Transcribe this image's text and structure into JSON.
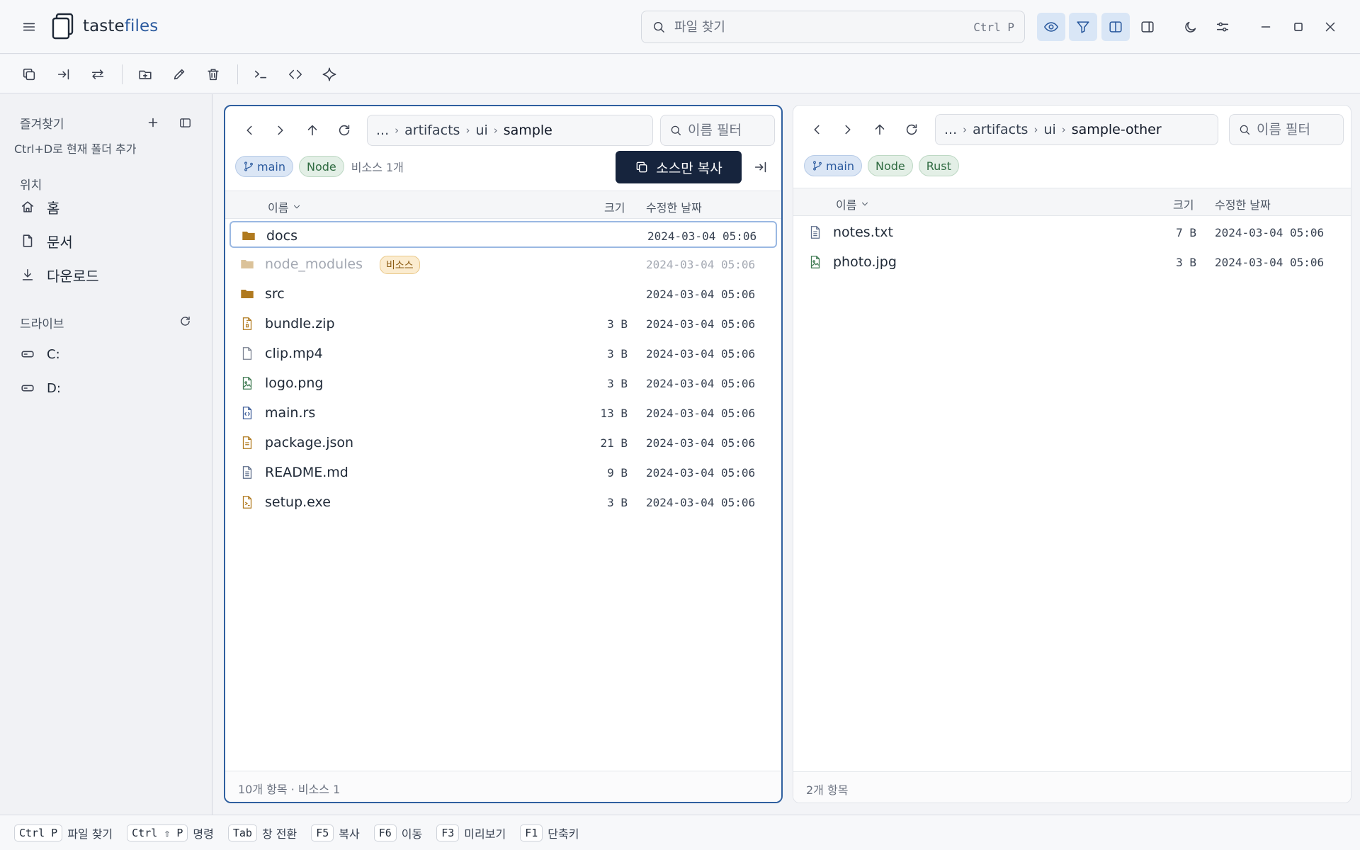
{
  "app": {
    "title_a": "taste",
    "title_b": "files"
  },
  "search": {
    "placeholder": "파일 찾기",
    "shortcut": "Ctrl P"
  },
  "sidebar": {
    "favorites_title": "즐겨찾기",
    "favorites_hint": "Ctrl+D로 현재 폴더 추가",
    "locations_title": "위치",
    "locations": [
      {
        "label": "홈",
        "icon": "home-icon"
      },
      {
        "label": "문서",
        "icon": "document-icon"
      },
      {
        "label": "다운로드",
        "icon": "download-icon"
      }
    ],
    "drives_title": "드라이브",
    "drives": [
      {
        "label": "C:"
      },
      {
        "label": "D:"
      }
    ]
  },
  "left": {
    "breadcrumb": [
      "...",
      "artifacts",
      "ui",
      "sample"
    ],
    "filter_placeholder": "이름 필터",
    "chips": [
      "main",
      "Node"
    ],
    "note": "비소스 1개",
    "copy_label": "소스만 복사",
    "headers": {
      "name": "이름",
      "size": "크기",
      "date": "수정한 날짜"
    },
    "rows": [
      {
        "name": "docs",
        "size": "",
        "date": "2024-03-04 05:06",
        "type": "folder",
        "selected": true
      },
      {
        "name": "node_modules",
        "size": "",
        "date": "2024-03-04 05:06",
        "type": "folder",
        "dim": true,
        "badge": "비소스"
      },
      {
        "name": "src",
        "size": "",
        "date": "2024-03-04 05:06",
        "type": "folder"
      },
      {
        "name": "bundle.zip",
        "size": "3 B",
        "date": "2024-03-04 05:06",
        "type": "zip"
      },
      {
        "name": "clip.mp4",
        "size": "3 B",
        "date": "2024-03-04 05:06",
        "type": "file"
      },
      {
        "name": "logo.png",
        "size": "3 B",
        "date": "2024-03-04 05:06",
        "type": "image"
      },
      {
        "name": "main.rs",
        "size": "13 B",
        "date": "2024-03-04 05:06",
        "type": "code"
      },
      {
        "name": "package.json",
        "size": "21 B",
        "date": "2024-03-04 05:06",
        "type": "json"
      },
      {
        "name": "README.md",
        "size": "9 B",
        "date": "2024-03-04 05:06",
        "type": "text"
      },
      {
        "name": "setup.exe",
        "size": "3 B",
        "date": "2024-03-04 05:06",
        "type": "exe"
      }
    ],
    "status": "10개 항목 · 비소스 1"
  },
  "right": {
    "breadcrumb": [
      "...",
      "artifacts",
      "ui",
      "sample-other"
    ],
    "filter_placeholder": "이름 필터",
    "chips": [
      "main",
      "Node",
      "Rust"
    ],
    "headers": {
      "name": "이름",
      "size": "크기",
      "date": "수정한 날짜"
    },
    "rows": [
      {
        "name": "notes.txt",
        "size": "7 B",
        "date": "2024-03-04 05:06",
        "type": "text"
      },
      {
        "name": "photo.jpg",
        "size": "3 B",
        "date": "2024-03-04 05:06",
        "type": "image"
      }
    ],
    "status": "2개 항목"
  },
  "shortcuts": [
    {
      "key": "Ctrl P",
      "label": "파일 찾기"
    },
    {
      "key": "Ctrl ⇧ P",
      "label": "명령"
    },
    {
      "key": "Tab",
      "label": "창 전환"
    },
    {
      "key": "F5",
      "label": "복사"
    },
    {
      "key": "F6",
      "label": "이동"
    },
    {
      "key": "F3",
      "label": "미리보기"
    },
    {
      "key": "F1",
      "label": "단축키"
    }
  ],
  "colors": {
    "accent": "#2f5f9f",
    "primary_button": "#16243d",
    "folder": "#b07a1f"
  }
}
